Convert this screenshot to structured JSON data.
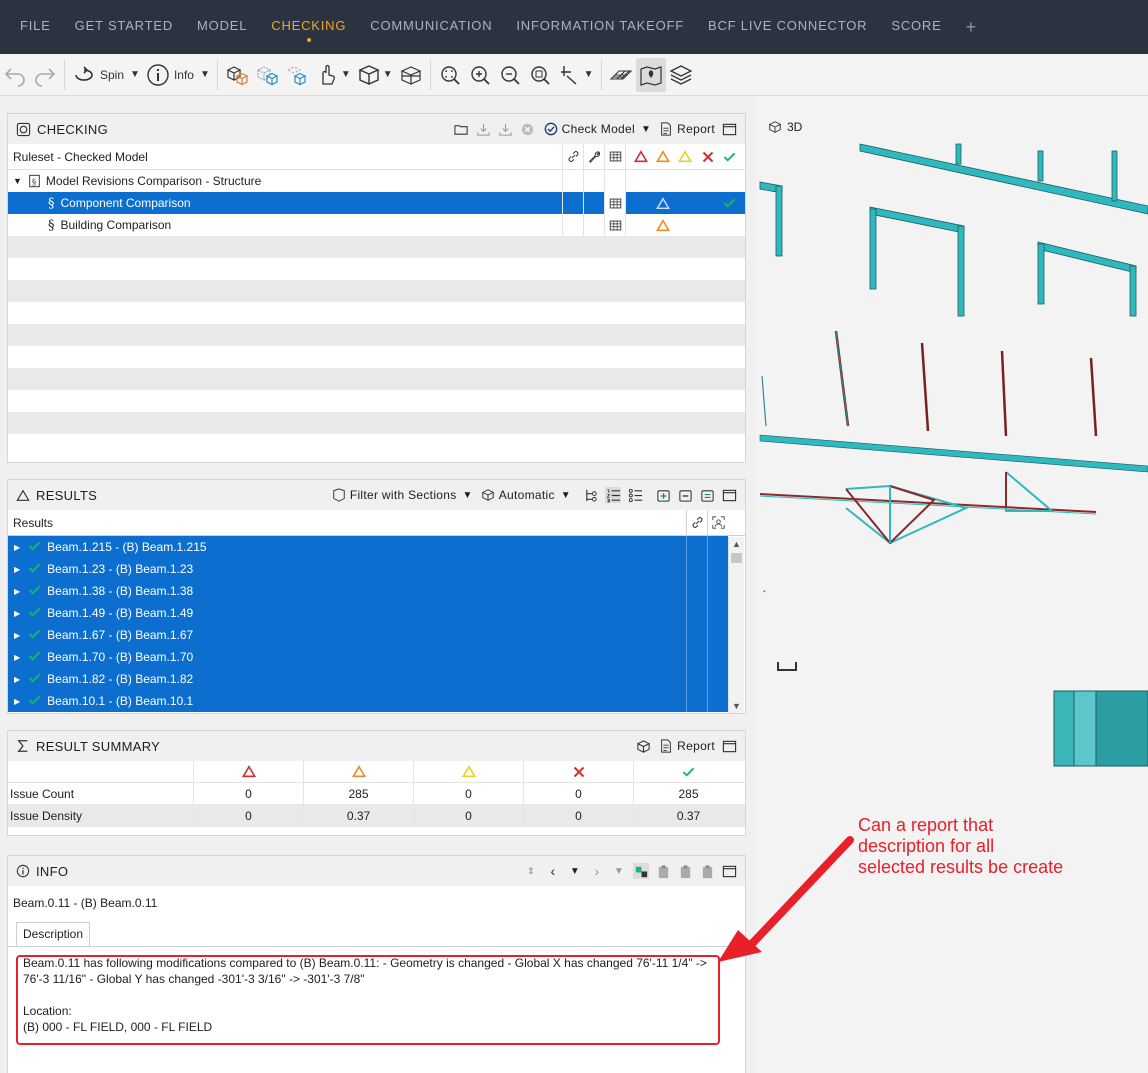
{
  "menu": {
    "items": [
      "FILE",
      "GET STARTED",
      "MODEL",
      "CHECKING",
      "COMMUNICATION",
      "INFORMATION TAKEOFF",
      "BCF LIVE CONNECTOR",
      "SCORE"
    ],
    "active": "CHECKING",
    "add": "+"
  },
  "toolbar": {
    "spin_label": "Spin",
    "info_label": "Info"
  },
  "checking": {
    "title": "CHECKING",
    "check_model_label": "Check Model",
    "report_label": "Report",
    "column_header": "Ruleset - Checked Model",
    "tree": {
      "root": "Model Revisions Comparison - Structure",
      "children": [
        "Component Comparison",
        "Building Comparison"
      ]
    }
  },
  "results": {
    "title": "RESULTS",
    "filter_label": "Filter with Sections",
    "mode_label": "Automatic",
    "column_header": "Results",
    "rows": [
      "Beam.1.215 - (B) Beam.1.215",
      "Beam.1.23 - (B) Beam.1.23",
      "Beam.1.38 - (B) Beam.1.38",
      "Beam.1.49 - (B) Beam.1.49",
      "Beam.1.67 - (B) Beam.1.67",
      "Beam.1.70 - (B) Beam.1.70",
      "Beam.1.82 - (B) Beam.1.82",
      "Beam.10.1 - (B) Beam.10.1"
    ]
  },
  "summary": {
    "title": "RESULT SUMMARY",
    "report_label": "Report",
    "rows": [
      {
        "label": "Issue Count",
        "values": [
          "0",
          "285",
          "0",
          "0",
          "285"
        ]
      },
      {
        "label": "Issue Density",
        "values": [
          "0",
          "0.37",
          "0",
          "0",
          "0.37"
        ]
      }
    ]
  },
  "info": {
    "title": "INFO",
    "object_title": "Beam.0.11 - (B) Beam.0.11",
    "tab_label": "Description",
    "desc_line1": "Beam.0.11 has following modifications compared to (B) Beam.0.11: - Geometry is changed - Global X has changed 76'-11 1/4\" ->",
    "desc_line2": "76'-3 11/16\" - Global Y has changed -301'-3 3/16\" -> -301'-3 7/8\"",
    "location_label": "Location:",
    "location_value": "(B) 000 - FL FIELD, 000 - FL FIELD"
  },
  "viewport": {
    "label": "3D"
  },
  "annotation": {
    "text_lines": [
      "Can a report that",
      "description for all",
      "selected results be create"
    ]
  },
  "colors": {
    "menubar": "#2b3340",
    "active": "#f5a623",
    "selection": "#0c6fcf",
    "critical": "#d32f2f",
    "major": "#f08a24",
    "minor": "#e8d31c",
    "rejected": "#d32f2f",
    "accepted": "#1cb36b",
    "annotation": "#e8202a",
    "beam_cyan": "#2fb8bd",
    "beam_red": "#8a2a2a"
  }
}
